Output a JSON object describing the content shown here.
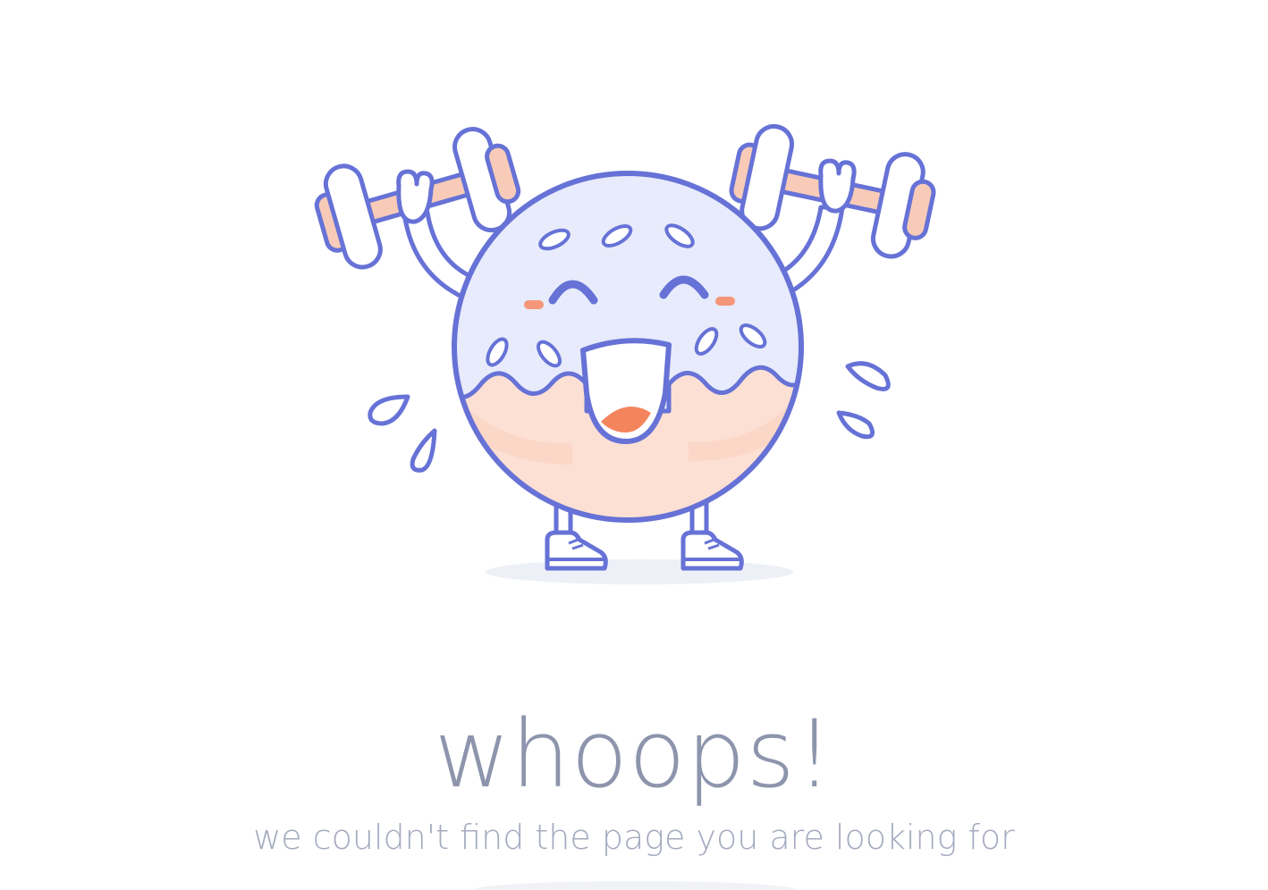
{
  "error": {
    "heading": "whoops!",
    "message": "we couldn't find the page you are looking for"
  },
  "illustration": {
    "subject": "donut-lifting-dumbbells",
    "colors": {
      "outline": "#6672d6",
      "icing": "#e7ebfb",
      "dough": "#fde0d4",
      "accent": "#f8c3ab",
      "cheeks": "#f5967a",
      "tongue": "#f4845c",
      "shadow": "#eef0f7"
    }
  },
  "theme": {
    "heading_color": "#8d95ad",
    "text_color": "#a4aabf",
    "background": "#ffffff"
  }
}
